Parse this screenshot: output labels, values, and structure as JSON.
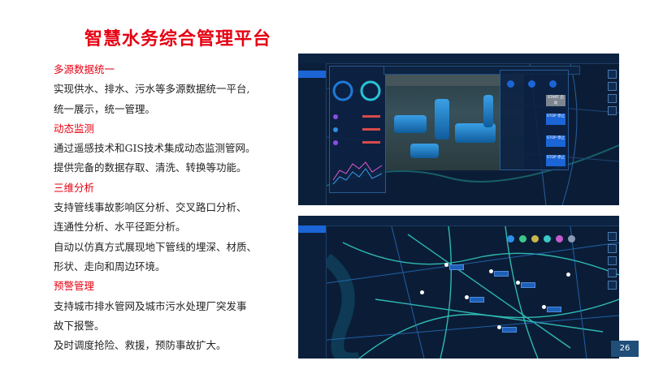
{
  "slide": {
    "title": "智慧水务综合管理平台",
    "page_number": "26"
  },
  "sections": [
    {
      "heading": "多源数据统一",
      "lines": [
        "实现供水、排水、污水等多源数据统一平台,",
        "统一展示，统一管理。"
      ]
    },
    {
      "heading": "动态监测",
      "lines": [
        "通过遥感技术和GIS技术集成动态监测管网。",
        "提供完备的数据存取、清洗、转换等功能。"
      ]
    },
    {
      "heading": "三维分析",
      "lines": [
        "支持管线事故影响区分析、交叉路口分析、",
        "连通性分析、水平径距分析。",
        "自动以仿真方式展现地下管线的埋深、材质、",
        "形状、走向和周边环境。"
      ]
    },
    {
      "heading": "预警管理",
      "lines": [
        "支持城市排水管网及城市污水处理厂突发事",
        "故下报警。",
        "及时调度抢险、救援，预防事故扩大。"
      ]
    }
  ],
  "screenshot1": {
    "buttons": [
      "START 启动",
      "STOP 停止",
      "STOP 停止",
      "STOP 停止"
    ]
  },
  "colors": {
    "accent_red": "#e60012",
    "page_badge": "#1f4e79",
    "ui_bg": "#0a1a30",
    "ui_active": "#1b65d6"
  }
}
